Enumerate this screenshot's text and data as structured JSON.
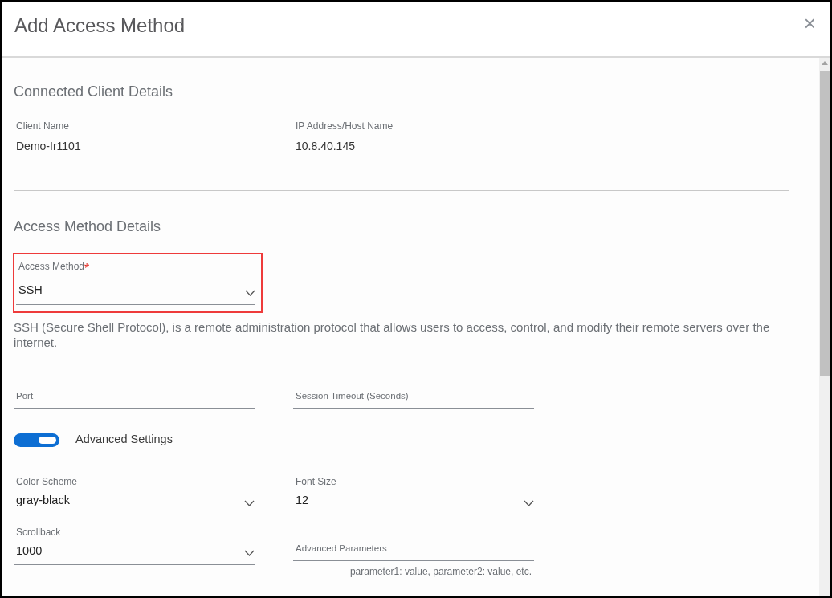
{
  "dialog": {
    "title": "Add Access Method",
    "close_icon": "×"
  },
  "client_section": {
    "title": "Connected Client Details",
    "items": [
      {
        "label": "Client Name",
        "value": "Demo-Ir1101"
      },
      {
        "label": "IP Address/Host Name",
        "value": "10.8.40.145"
      }
    ]
  },
  "method_section": {
    "title": "Access Method Details",
    "access_method": {
      "label": "Access Method",
      "required": true,
      "required_mark": "*",
      "value": "SSH",
      "highlighted": true
    },
    "description": "SSH (Secure Shell Protocol), is a remote administration protocol that allows users to access, control, and modify their remote servers over the internet.",
    "connection_fields": [
      {
        "kind": "text",
        "placeholder": "Port"
      },
      {
        "kind": "text",
        "placeholder": "Session Timeout (Seconds)"
      }
    ],
    "advanced_toggle": {
      "label": "Advanced Settings",
      "on": true
    },
    "advanced_fields": [
      {
        "kind": "select",
        "label": "Color Scheme",
        "value": "gray-black"
      },
      {
        "kind": "select",
        "label": "Font Size",
        "value": "12"
      },
      {
        "kind": "select",
        "label": "Scrollback",
        "value": "1000"
      },
      {
        "kind": "text",
        "placeholder": "Advanced Parameters",
        "hint": "parameter1: value, parameter2: value, etc."
      }
    ]
  }
}
